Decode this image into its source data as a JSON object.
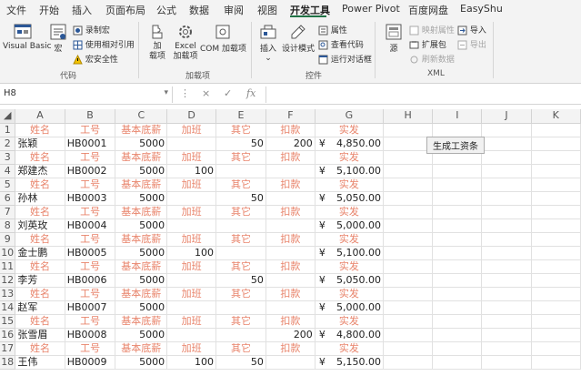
{
  "menu": {
    "tabs": [
      "文件",
      "开始",
      "插入",
      "页面布局",
      "公式",
      "数据",
      "审阅",
      "视图",
      "开发工具",
      "Power Pivot",
      "百度网盘",
      "EasyShu"
    ],
    "active": "开发工具"
  },
  "ribbon": {
    "code": {
      "visual_basic": "Visual Basic",
      "macros": "宏",
      "record_macro": "录制宏",
      "relative_refs": "使用相对引用",
      "macro_security": "宏安全性",
      "group_label": "代码"
    },
    "addins": {
      "addins": "加\n载项",
      "excel_addins": "Excel\n加载项",
      "com_addins": "COM 加载项",
      "group_label": "加载项"
    },
    "controls": {
      "insert": "插入",
      "design_mode": "设计模式",
      "properties": "属性",
      "view_code": "查看代码",
      "run_dialog": "运行对话框",
      "group_label": "控件"
    },
    "xml": {
      "source": "源",
      "map_properties": "映射属性",
      "expansion_packs": "扩展包",
      "refresh_data": "刷新数据",
      "import": "导入",
      "export": "导出",
      "group_label": "XML"
    }
  },
  "formula_bar": {
    "name_box": "H8",
    "cancel": "×",
    "enter": "✓",
    "fx": "fx",
    "value": ""
  },
  "columns": [
    "A",
    "B",
    "C",
    "D",
    "E",
    "F",
    "G",
    "H",
    "I",
    "J",
    "K"
  ],
  "header_labels": {
    "a": "姓名",
    "b": "工号",
    "c": "基本底薪",
    "d": "加班",
    "e": "其它",
    "f": "扣款",
    "g": "实发"
  },
  "employees": [
    {
      "name": "张颖",
      "id": "HB0001",
      "base": "5000",
      "overtime": "",
      "other": "50",
      "deduction": "200",
      "currency": "¥",
      "net": "4,850.00"
    },
    {
      "name": "郑建杰",
      "id": "HB0002",
      "base": "5000",
      "overtime": "100",
      "other": "",
      "deduction": "",
      "currency": "¥",
      "net": "5,100.00"
    },
    {
      "name": "孙林",
      "id": "HB0003",
      "base": "5000",
      "overtime": "",
      "other": "50",
      "deduction": "",
      "currency": "¥",
      "net": "5,050.00"
    },
    {
      "name": "刘英玫",
      "id": "HB0004",
      "base": "5000",
      "overtime": "",
      "other": "",
      "deduction": "",
      "currency": "¥",
      "net": "5,000.00"
    },
    {
      "name": "金士鹏",
      "id": "HB0005",
      "base": "5000",
      "overtime": "100",
      "other": "",
      "deduction": "",
      "currency": "¥",
      "net": "5,100.00"
    },
    {
      "name": "李芳",
      "id": "HB0006",
      "base": "5000",
      "overtime": "",
      "other": "50",
      "deduction": "",
      "currency": "¥",
      "net": "5,050.00"
    },
    {
      "name": "赵军",
      "id": "HB0007",
      "base": "5000",
      "overtime": "",
      "other": "",
      "deduction": "",
      "currency": "¥",
      "net": "5,000.00"
    },
    {
      "name": "张雪眉",
      "id": "HB0008",
      "base": "5000",
      "overtime": "",
      "other": "",
      "deduction": "200",
      "currency": "¥",
      "net": "4,800.00"
    },
    {
      "name": "王伟",
      "id": "HB0009",
      "base": "5000",
      "overtime": "100",
      "other": "50",
      "deduction": "",
      "currency": "¥",
      "net": "5,150.00"
    }
  ],
  "button": {
    "label": "生成工资条"
  },
  "colors": {
    "accent": "#217346",
    "label_red": "#e8846b"
  }
}
